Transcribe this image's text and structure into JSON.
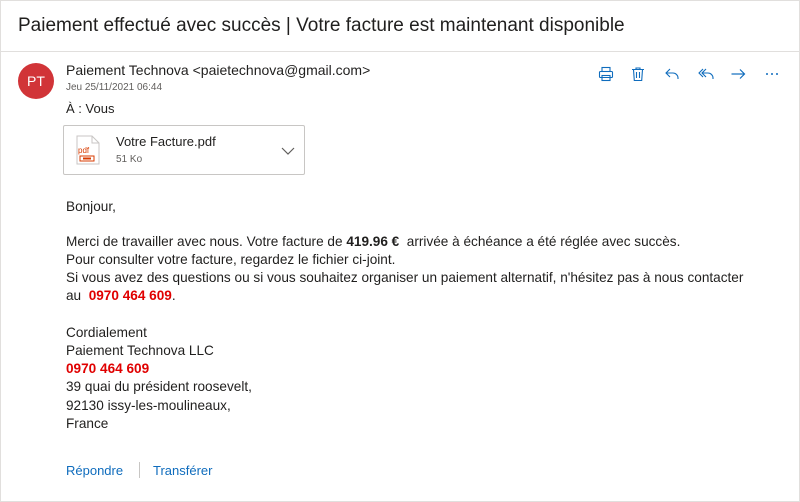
{
  "message": {
    "subject": "Paiement effectué avec succès | Votre facture est maintenant disponible",
    "avatar_initials": "PT",
    "avatar_color": "#d13438",
    "sender": "Paiement Technova <paietechnova@gmail.com>",
    "date": "Jeu 25/11/2021 06:44",
    "to_label": "À :",
    "to_value": "Vous"
  },
  "toolbar": {
    "icons": [
      "print-icon",
      "delete-icon",
      "reply-icon",
      "reply-all-icon",
      "forward-icon",
      "more-icon"
    ]
  },
  "attachment": {
    "filename": "Votre Facture.pdf",
    "size": "51 Ko",
    "icon_label": "pdf"
  },
  "body": {
    "greeting": "Bonjour,",
    "line1_before": "Merci de travailler avec nous. Votre facture de ",
    "amount": "419.96 €",
    "line1_after": "  arrivée à échéance a été réglée avec succès.",
    "line2": "Pour consulter votre facture, regardez le fichier ci-joint.",
    "line3": "Si vous avez des questions ou si vous souhaitez organiser un paiement alternatif, n'hésitez pas à nous contacter",
    "line4_before": "au  ",
    "phone": "0970 464 609",
    "line4_after": ".",
    "closing": "Cordialement",
    "company": "Paiement Technova LLC",
    "address1": "39 quai du président roosevelt,",
    "address2": "92130 issy-les-moulineaux,",
    "country": "France"
  },
  "footer": {
    "reply": "Répondre",
    "forward": "Transférer"
  },
  "colors": {
    "accent": "#0f6cbd",
    "highlight_red": "#e00000",
    "icon_blue": "#0f6cbd"
  }
}
